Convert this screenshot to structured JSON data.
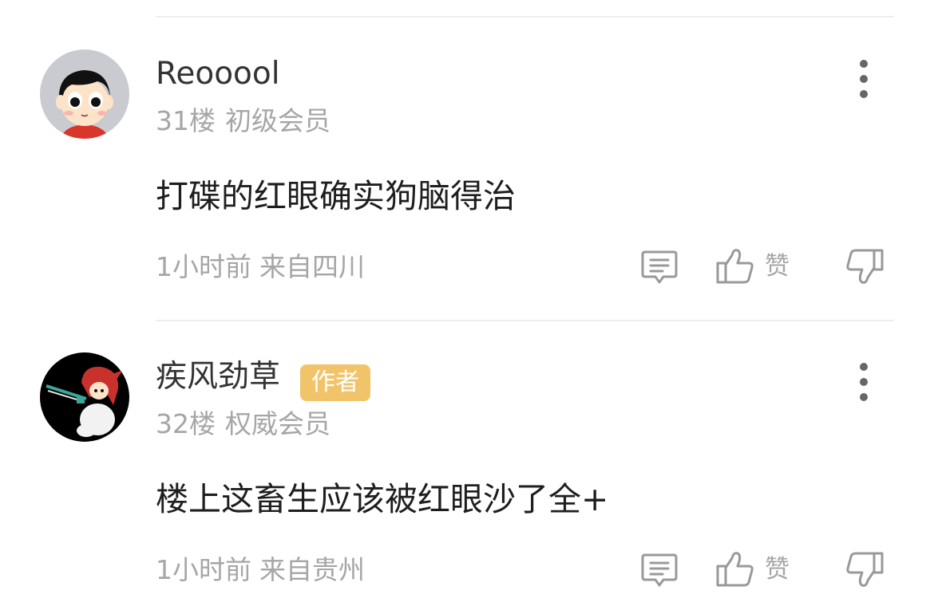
{
  "comments": [
    {
      "username": "Reooool",
      "badge": "",
      "floor": "31楼",
      "level": "初级会员",
      "content": "打碟的红眼确实狗脑得治",
      "time": "1小时前",
      "location": "来自四川",
      "like_label": "赞",
      "avatar_icon": "cartoon-boy-avatar",
      "colors": {
        "avatar_bg": "#c9cbd0",
        "face": "#fde3c8",
        "hair": "#111111",
        "shirt": "#d8362b"
      }
    },
    {
      "username": "疾风劲草",
      "badge": "作者",
      "floor": "32楼",
      "level": "权威会员",
      "content": "楼上这畜生应该被红眼沙了全+",
      "time": "1小时前",
      "location": "来自贵州",
      "like_label": "赞",
      "avatar_icon": "pixel-swordsman-avatar",
      "colors": {
        "avatar_bg": "#000000",
        "hair": "#c8312c",
        "sword": "#3aa79b",
        "badge": "#f2c46a"
      }
    }
  ],
  "icons": {
    "more": "more-vertical-icon",
    "reply": "comment-icon",
    "like": "thumbs-up-icon",
    "dislike": "thumbs-down-icon"
  },
  "colors": {
    "text_primary": "#1e1e1e",
    "text_secondary": "#a6a6a6",
    "divider": "#eeeeee",
    "icon": "#999999"
  }
}
